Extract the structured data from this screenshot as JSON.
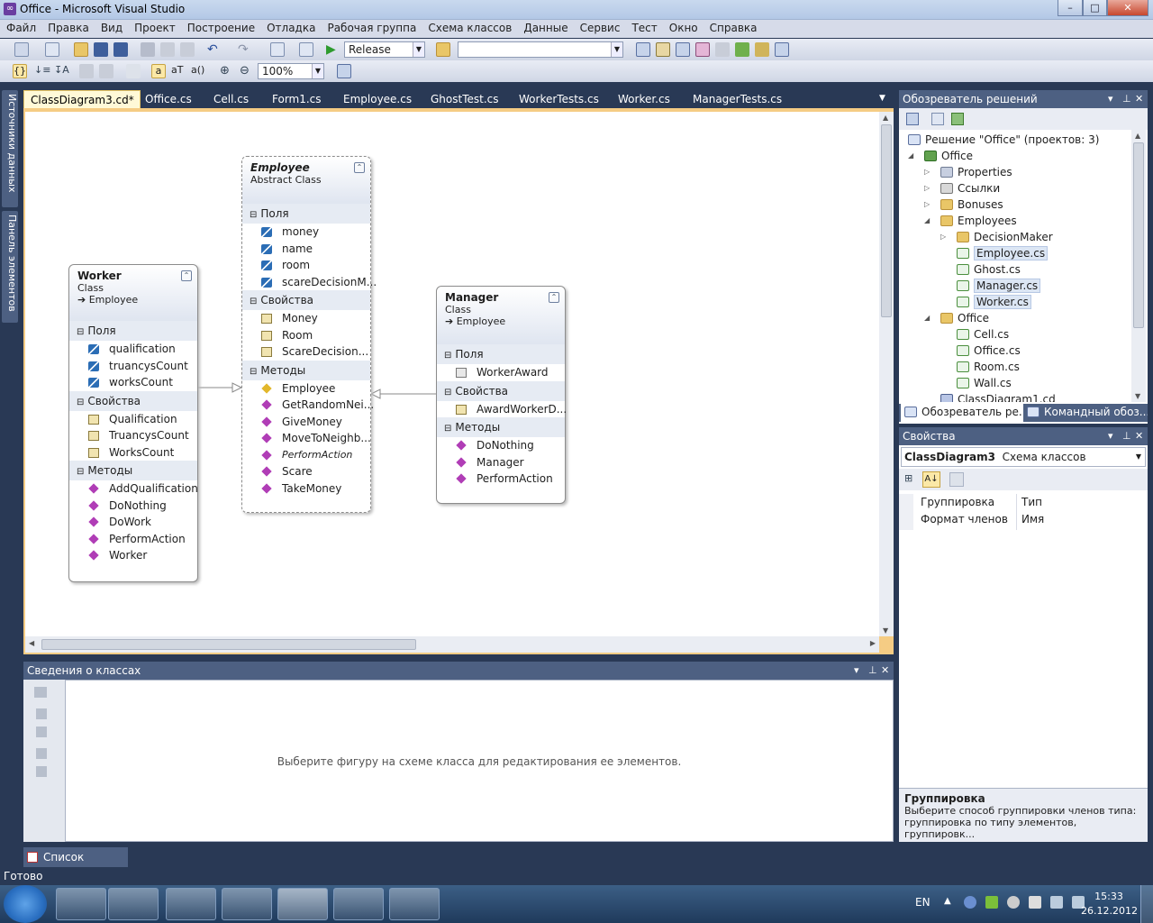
{
  "window": {
    "title": "Office - Microsoft Visual Studio",
    "min": "–",
    "max": "□",
    "close": "✕"
  },
  "menu": [
    "Файл",
    "Правка",
    "Вид",
    "Проект",
    "Построение",
    "Отладка",
    "Рабочая группа",
    "Схема классов",
    "Данные",
    "Сервис",
    "Тест",
    "Окно",
    "Справка"
  ],
  "toolbar": {
    "config": "Release",
    "platform": "",
    "zoom": "100%",
    "text_a": "a",
    "text_at": "aT",
    "text_ac": "a()"
  },
  "side_tabs": [
    "Источники данных",
    "Панель элементов"
  ],
  "doc_tabs": [
    {
      "label": "ClassDiagram3.cd*",
      "close": "✕"
    },
    {
      "label": "Office.cs"
    },
    {
      "label": "Cell.cs"
    },
    {
      "label": "Form1.cs"
    },
    {
      "label": "Employee.cs"
    },
    {
      "label": "GhostTest.cs"
    },
    {
      "label": "WorkerTests.cs"
    },
    {
      "label": "Worker.cs"
    },
    {
      "label": "ManagerTests.cs"
    }
  ],
  "diagram": {
    "worker": {
      "name": "Worker",
      "kind": "Class",
      "inherits": "Employee",
      "sections": [
        {
          "title": "Поля",
          "items": [
            "qualification",
            "truancysCount",
            "worksCount"
          ]
        },
        {
          "title": "Свойства",
          "items": [
            "Qualification",
            "TruancysCount",
            "WorksCount"
          ]
        },
        {
          "title": "Методы",
          "items": [
            "AddQualification",
            "DoNothing",
            "DoWork",
            "PerformAction",
            "Worker"
          ]
        }
      ]
    },
    "employee": {
      "name": "Employee",
      "kind": "Abstract Class",
      "sections": [
        {
          "title": "Поля",
          "items": [
            "money",
            "name",
            "room",
            "scareDecisionM..."
          ]
        },
        {
          "title": "Свойства",
          "items": [
            "Money",
            "Room",
            "ScareDecision..."
          ]
        },
        {
          "title": "Методы",
          "items": [
            "Employee",
            "GetRandomNei...",
            "GiveMoney",
            "MoveToNeighb...",
            "PerformAction",
            "Scare",
            "TakeMoney"
          ]
        }
      ]
    },
    "manager": {
      "name": "Manager",
      "kind": "Class",
      "inherits": "Employee",
      "sections": [
        {
          "title": "Поля",
          "items": [
            "WorkerAward"
          ]
        },
        {
          "title": "Свойства",
          "items": [
            "AwardWorkerD..."
          ]
        },
        {
          "title": "Методы",
          "items": [
            "DoNothing",
            "Manager",
            "PerformAction"
          ]
        }
      ]
    }
  },
  "class_details": {
    "title": "Сведения о классах",
    "hint": "Выберите фигуру на схеме класса для редактирования ее элементов."
  },
  "solution_explorer": {
    "title": "Обозреватель решений",
    "rows": [
      {
        "text": "Решение \"Office\"  (проектов: 3)"
      },
      {
        "text": "Office"
      },
      {
        "text": "Properties"
      },
      {
        "text": "Ссылки"
      },
      {
        "text": "Bonuses"
      },
      {
        "text": "Employees"
      },
      {
        "text": "DecisionMaker"
      },
      {
        "text": "Employee.cs"
      },
      {
        "text": "Ghost.cs"
      },
      {
        "text": "Manager.cs"
      },
      {
        "text": "Worker.cs"
      },
      {
        "text": "Office"
      },
      {
        "text": "Cell.cs"
      },
      {
        "text": "Office.cs"
      },
      {
        "text": "Room.cs"
      },
      {
        "text": "Wall.cs"
      },
      {
        "text": "ClassDiagram1.cd"
      }
    ],
    "bottom_tabs": [
      "Обозреватель ре...",
      "Командный обоз..."
    ]
  },
  "properties": {
    "title": "Свойства",
    "object_name": "ClassDiagram3",
    "object_type": "Схема классов",
    "grid": [
      {
        "name": "Группировка",
        "value": "Тип"
      },
      {
        "name": "Формат членов",
        "value": "Имя"
      }
    ],
    "desc_title": "Группировка",
    "desc_text": "Выберите способ группировки членов типа: группировка по типу элементов, группировк..."
  },
  "error_list_tab": "Список ошибок",
  "status": "Готово",
  "tray": {
    "lang": "EN",
    "time": "15:33",
    "date": "26.12.2012"
  }
}
